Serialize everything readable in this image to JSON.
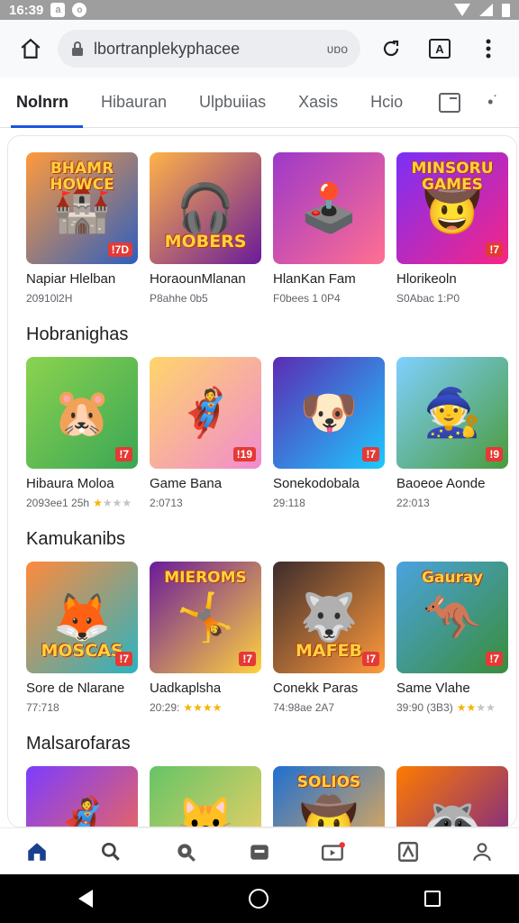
{
  "status_bar": {
    "time": "16:39",
    "badge_icon": "a",
    "dot_icon": "o"
  },
  "browser": {
    "url_text": "lbortranplekyphacee",
    "url_suffix": "ʋɒo",
    "tab_action_label": "A"
  },
  "tabs": [
    {
      "label": "Nolnrn",
      "active": true
    },
    {
      "label": "Hibauran"
    },
    {
      "label": "Ulpbuiias"
    },
    {
      "label": "Xasis"
    },
    {
      "label": "Hcio"
    }
  ],
  "sections": [
    {
      "title": "",
      "items": [
        {
          "title": "Napiar Hlelban",
          "sub": "20910l2H",
          "logo": "BHAMR HOWCE",
          "badge": "!7D",
          "glyph": "🏰",
          "colors": [
            "#ff9a3c",
            "#2d5fbf"
          ]
        },
        {
          "title": "HoraounMlanan",
          "sub": "P8ahhe 0b5",
          "logo": "MOBERS",
          "logo_pos": "bottom",
          "badge": "",
          "glyph": "🎧",
          "colors": [
            "#ffb347",
            "#6a1b9a"
          ]
        },
        {
          "title": "HlanKan Fam",
          "sub": "F0bees 1 0P4",
          "logo": "",
          "badge": "",
          "glyph": "🕹️",
          "colors": [
            "#9d38c9",
            "#ff6f91"
          ]
        },
        {
          "title": "Hlorikeoln",
          "sub": "S0Abac 1:P0",
          "logo": "MINSORU GAMES",
          "badge": "!7",
          "glyph": "🤠",
          "colors": [
            "#7b2ff7",
            "#f72585"
          ]
        }
      ]
    },
    {
      "title": "Hobranighas",
      "items": [
        {
          "title": "Hibaura Moloa",
          "sub": "2093ee1 25h",
          "stars": 1,
          "badge": "!7",
          "glyph": "🐹",
          "colors": [
            "#8bd34f",
            "#3aa655"
          ]
        },
        {
          "title": "Game Bana",
          "sub": "2:0713",
          "badge": "!19",
          "glyph": "🦸",
          "colors": [
            "#ffd56b",
            "#f08bd0"
          ]
        },
        {
          "title": "Sonekodobala",
          "sub": "29:118",
          "badge": "!7",
          "glyph": "🐶",
          "colors": [
            "#5b2bb3",
            "#1ec8ff"
          ]
        },
        {
          "title": "Baoeoe Aonde",
          "sub": "22:013",
          "badge": "!9",
          "glyph": "🧙",
          "colors": [
            "#7fd0ff",
            "#4a9b3c"
          ]
        }
      ]
    },
    {
      "title": "Kamukanibs",
      "items": [
        {
          "title": "Sore de Nlarane",
          "sub": "77:718",
          "logo": "MOSCAS",
          "logo_pos": "bottom",
          "badge": "!7",
          "glyph": "🦊",
          "colors": [
            "#ff8a3d",
            "#2bb3c0"
          ]
        },
        {
          "title": "Uadkaplsha",
          "sub": "20:29:",
          "stars": 4,
          "logo": "MIEROMS",
          "badge": "!7",
          "glyph": "🤸",
          "colors": [
            "#6a1b9a",
            "#ffd23f"
          ]
        },
        {
          "title": "Conekk Paras",
          "sub": "74:98ae 2A7",
          "logo": "MAFEB",
          "logo_pos": "bottom",
          "badge": "!7",
          "glyph": "🐺",
          "colors": [
            "#3d2c2c",
            "#ff9a3c"
          ]
        },
        {
          "title": "Same Vlahe",
          "sub": "39:90 (3B3)",
          "stars": 2,
          "logo": "Gauray",
          "badge": "!7",
          "glyph": "🦘",
          "colors": [
            "#4aa3df",
            "#3a8d3a"
          ]
        }
      ]
    },
    {
      "title": "Malsarofaras",
      "items": [
        {
          "title": "",
          "sub": "",
          "badge": "",
          "glyph": "🦸",
          "colors": [
            "#7d3cff",
            "#ff6e40"
          ]
        },
        {
          "title": "",
          "sub": "",
          "badge": "",
          "glyph": "🐱",
          "colors": [
            "#65c466",
            "#ffd166"
          ]
        },
        {
          "title": "",
          "sub": "",
          "logo": "SOLIOS",
          "badge": "",
          "glyph": "🤠",
          "colors": [
            "#1f6fd1",
            "#ffb347"
          ]
        },
        {
          "title": "",
          "sub": "",
          "badge": "",
          "glyph": "🦝",
          "colors": [
            "#ff7b00",
            "#6a1b9a"
          ]
        }
      ]
    }
  ],
  "bottom_nav": [
    {
      "icon": "home-icon",
      "active": true
    },
    {
      "icon": "search-icon"
    },
    {
      "icon": "discover-icon"
    },
    {
      "icon": "wallet-icon"
    },
    {
      "icon": "video-icon"
    },
    {
      "icon": "apps-icon"
    },
    {
      "icon": "profile-icon"
    }
  ],
  "colors": {
    "accent": "#1a56db",
    "star": "#f5b400",
    "badge": "#e53935"
  }
}
